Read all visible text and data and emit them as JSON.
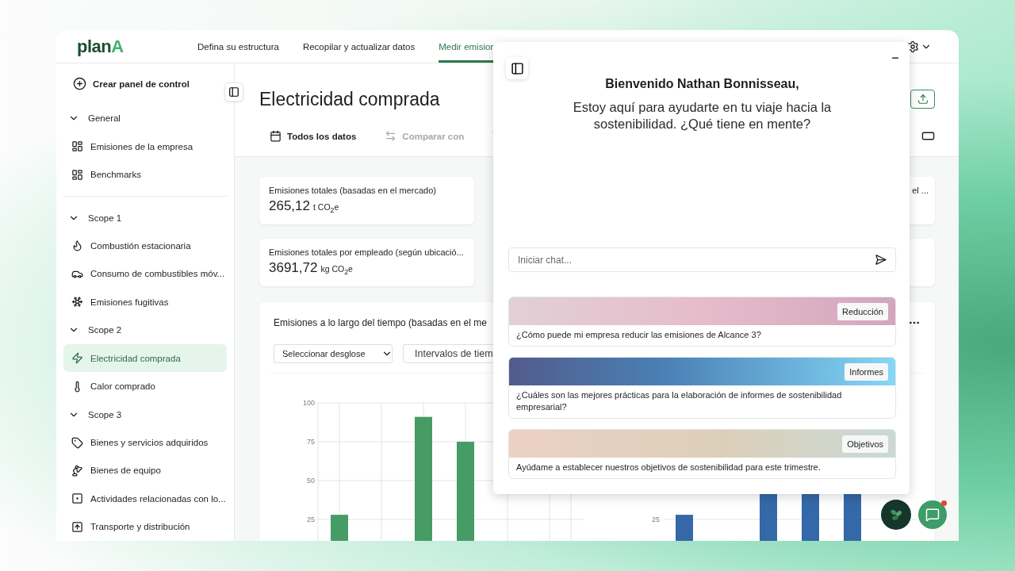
{
  "header": {
    "logo": {
      "text": "plan",
      "accent": "A"
    },
    "tabs": [
      {
        "label": "Defina su estructura",
        "selected": false
      },
      {
        "label": "Recopilar y actualizar datos",
        "selected": false
      },
      {
        "label": "Medir emision",
        "selected": true
      }
    ]
  },
  "sidebar": {
    "create_button": "Crear panel de control",
    "groups": [
      {
        "label": "General",
        "expanded": true,
        "items": [
          {
            "label": "Emisiones de la empresa",
            "selected": false
          },
          {
            "label": "Benchmarks",
            "selected": false
          }
        ]
      },
      {
        "label": "Scope 1",
        "expanded": true,
        "items": [
          {
            "label": "Combustión estacionaria",
            "selected": false
          },
          {
            "label": "Consumo de combustibles móv...",
            "selected": false
          },
          {
            "label": "Emisiones fugitivas",
            "selected": false
          }
        ]
      },
      {
        "label": "Scope 2",
        "expanded": true,
        "items": [
          {
            "label": "Electricidad comprada",
            "selected": true
          },
          {
            "label": "Calor comprado",
            "selected": false
          }
        ]
      },
      {
        "label": "Scope 3",
        "expanded": true,
        "items": [
          {
            "label": "Bienes y servicios adquiridos",
            "selected": false
          },
          {
            "label": "Bienes de equipo",
            "selected": false
          },
          {
            "label": "Actividades relacionadas con lo...",
            "selected": false
          },
          {
            "label": "Transporte y distribución",
            "selected": false
          }
        ]
      }
    ]
  },
  "page": {
    "title": "Electricidad comprada",
    "filters": [
      {
        "label": "Todos los datos",
        "disabled": false
      },
      {
        "label": "Comparar con",
        "disabled": true
      }
    ]
  },
  "metrics": [
    {
      "label": "Emisiones totales (basadas en el mercado)",
      "value": "265,12",
      "unit": "t CO$_{2}$e"
    },
    {
      "label": "Emisiones totales por empleado (según ubicació...",
      "value": "3691,72",
      "unit": "kg CO$_{2}$e"
    }
  ],
  "side_metric": {
    "label": "el ..."
  },
  "chart_card": {
    "title": "Emisiones a lo largo del tiempo (basadas en el me",
    "breakdown_select": "Seleccionar desglose",
    "interval_button": "Intervalos de tiem",
    "charts": [
      {
        "chart_data": {
          "type": "bar",
          "grid": true,
          "ylim": [
            0,
            100
          ],
          "yticks": [
            25,
            50,
            75,
            100
          ],
          "series": [
            {
              "color": "#479c65",
              "values": [
                28,
                null,
                91,
                75,
                null,
                null
              ]
            }
          ]
        }
      },
      {
        "kind": "drawing",
        "tick_label": "25"
      }
    ]
  },
  "assistant": {
    "welcome": "Bienvenido Nathan Bonnisseau,",
    "intro": "Estoy aquí para ayudarte en tu viaje hacia la sostenibilidad. ¿Qué tiene en mente?",
    "input": {
      "placeholder": "Iniciar chat..."
    },
    "suggestions": [
      {
        "tag": "Reducción",
        "question": "¿Cómo puede mi empresa reducir las emisiones de Alcance 3?"
      },
      {
        "tag": "Informes",
        "question": "¿Cuáles son las mejores prácticas para la elaboración de informes de sostenibilidad empresarial?"
      },
      {
        "tag": "Objetivos",
        "question": "Ayúdame a establecer nuestros objetivos de sostenibilidad para este trimestre."
      }
    ]
  },
  "chat_launcher": {
    "notification": true
  }
}
